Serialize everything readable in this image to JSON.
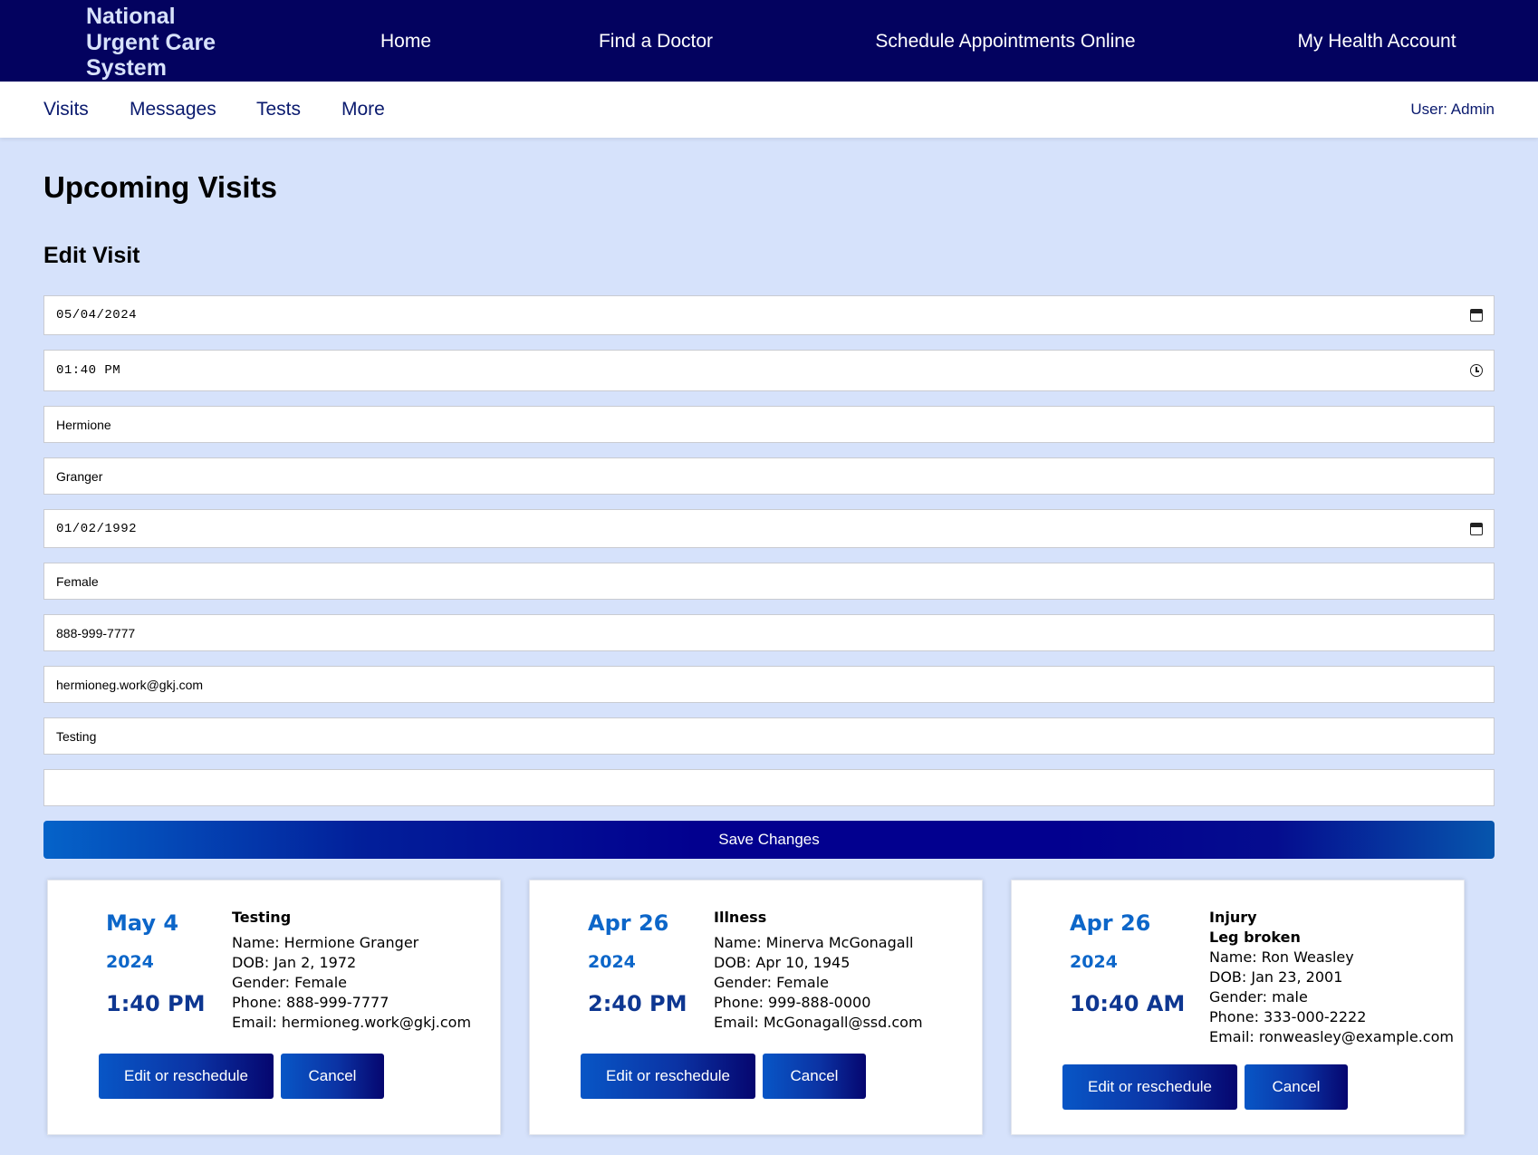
{
  "header": {
    "brand": "National Urgent Care System",
    "nav": [
      "Home",
      "Find a Doctor",
      "Schedule Appointments Online",
      "My Health Account"
    ]
  },
  "subnav": {
    "items": [
      "Visits",
      "Messages",
      "Tests",
      "More"
    ],
    "user": "User: Admin"
  },
  "page": {
    "title": "Upcoming Visits",
    "section_title": "Edit Visit"
  },
  "form": {
    "date": "05/04/2024",
    "time": "01:40 PM",
    "first_name": "Hermione",
    "last_name": "Granger",
    "dob": "01/02/1992",
    "gender": "Female",
    "phone": "888-999-7777",
    "email": "hermioneg.work@gkj.com",
    "reason": "Testing",
    "notes": "",
    "save_label": "Save Changes"
  },
  "visits": [
    {
      "date": "May 4",
      "year": "2024",
      "time": "1:40 PM",
      "reason": "Testing",
      "detail": "",
      "name": "Name: Hermione Granger",
      "dob": "DOB: Jan 2, 1972",
      "gender": "Gender: Female",
      "phone": "Phone: 888-999-7777",
      "email": "Email: hermioneg.work@gkj.com",
      "edit_label": "Edit or reschedule",
      "cancel_label": "Cancel"
    },
    {
      "date": "Apr 26",
      "year": "2024",
      "time": "2:40 PM",
      "reason": "Illness",
      "detail": "",
      "name": "Name: Minerva McGonagall",
      "dob": "DOB: Apr 10, 1945",
      "gender": "Gender: Female",
      "phone": "Phone: 999-888-0000",
      "email": "Email: McGonagall@ssd.com",
      "edit_label": "Edit or reschedule",
      "cancel_label": "Cancel"
    },
    {
      "date": "Apr 26",
      "year": "2024",
      "time": "10:40 AM",
      "reason": "Injury",
      "detail": "Leg broken",
      "name": "Name: Ron Weasley",
      "dob": "DOB: Jan 23, 2001",
      "gender": "Gender: male",
      "phone": "Phone: 333-000-2222",
      "email": "Email: ronweasley@example.com",
      "edit_label": "Edit or reschedule",
      "cancel_label": "Cancel"
    }
  ],
  "colors": {
    "header_bg": "#03025f",
    "page_bg": "#d6e2fb",
    "accent": "#0c66c9",
    "button_dark": "#02008f"
  }
}
